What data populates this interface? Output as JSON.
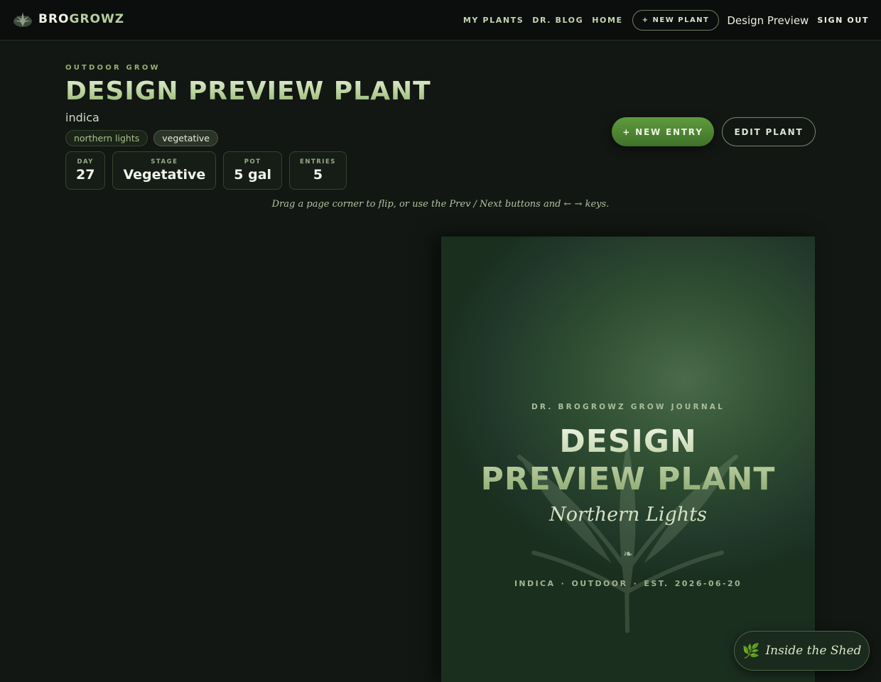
{
  "brand": {
    "name_part1": "BRO",
    "name_part2": "GROWZ",
    "logo_icon": "cannabis-leaf-logo"
  },
  "nav": {
    "links": [
      "MY PLANTS",
      "DR. BLOG",
      "HOME"
    ],
    "new_plant": "+ NEW PLANT",
    "user": "Design Preview",
    "sign_out": "SIGN OUT"
  },
  "header": {
    "eyebrow": "OUTDOOR GROW",
    "title": "DESIGN PREVIEW PLANT",
    "species": "indica",
    "tags": [
      "northern lights",
      "vegetative"
    ]
  },
  "stats": [
    {
      "label": "DAY",
      "value": "27"
    },
    {
      "label": "STAGE",
      "value": "Vegetative"
    },
    {
      "label": "POT",
      "value": "5 gal"
    },
    {
      "label": "ENTRIES",
      "value": "5"
    }
  ],
  "actions": {
    "new_entry": "+ NEW ENTRY",
    "edit_plant": "EDIT PLANT"
  },
  "hint": "Drag a page corner to flip, or use the Prev / Next buttons and ← → keys.",
  "cover": {
    "kicker": "DR. BROGROWZ GROW JOURNAL",
    "title_line1": "DESIGN",
    "title_line2": "PREVIEW PLANT",
    "strain": "Northern Lights",
    "ornament": "❧",
    "meta": "INDICA · OUTDOOR · EST. 2026-06-20"
  },
  "floating": {
    "label": "Inside the Shed",
    "icon": "herb-icon"
  },
  "colors": {
    "background": "#121713",
    "accent": "#5f9a3f",
    "cover": "#2f4e32"
  }
}
